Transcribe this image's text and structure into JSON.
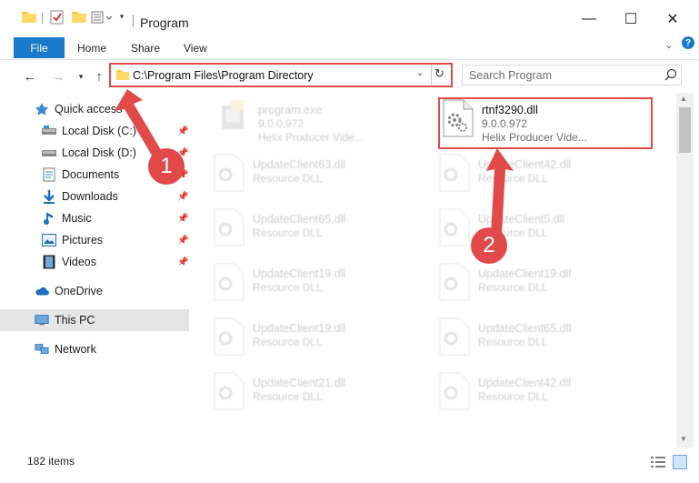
{
  "window": {
    "title": "Program",
    "minimize_glyph": "—",
    "maximize_glyph": "☐",
    "close_glyph": "✕"
  },
  "ribbon": {
    "tabs": [
      {
        "label": "File"
      },
      {
        "label": "Home"
      },
      {
        "label": "Share"
      },
      {
        "label": "View"
      }
    ]
  },
  "address": {
    "path": "C:\\Program Files\\Program Directory"
  },
  "search": {
    "placeholder": "Search Program"
  },
  "sidebar": {
    "items": [
      {
        "label": "Quick access",
        "icon": "star-icon"
      },
      {
        "label": "Local Disk (C:)",
        "icon": "drive-icon",
        "pinned": true
      },
      {
        "label": "Local Disk (D:)",
        "icon": "drive-icon",
        "pinned": true
      },
      {
        "label": "Documents",
        "icon": "documents-icon",
        "pinned": true
      },
      {
        "label": "Downloads",
        "icon": "download-icon",
        "pinned": true
      },
      {
        "label": "Music",
        "icon": "music-icon",
        "pinned": true
      },
      {
        "label": "Pictures",
        "icon": "pictures-icon",
        "pinned": true
      },
      {
        "label": "Videos",
        "icon": "videos-icon",
        "pinned": true
      },
      {
        "label": "OneDrive",
        "icon": "cloud-icon"
      },
      {
        "label": "This PC",
        "icon": "computer-icon",
        "selected": true
      },
      {
        "label": "Network",
        "icon": "network-icon"
      }
    ]
  },
  "files": {
    "program": {
      "name": "program.exe",
      "version": "9.0.0.972",
      "description": "Helix Producer Vide..."
    },
    "target": {
      "name": "rtnf3290.dll",
      "version": "9.0.0.972",
      "description": "Helix Producer Vide..."
    },
    "left_column": [
      {
        "name": "UpdateClient63.dll",
        "type": "Resource DLL"
      },
      {
        "name": "UpdateClient65.dll",
        "type": "Resource DLL"
      },
      {
        "name": "UpdateClient19.dll",
        "type": "Resource DLL"
      },
      {
        "name": "UpdateClient19.dll",
        "type": "Resource DLL"
      },
      {
        "name": "UpdateClient21.dll",
        "type": "Resource DLL"
      }
    ],
    "right_column": [
      {
        "name": "UpdateClient42.dll",
        "type": "Resource DLL"
      },
      {
        "name": "UpdateClient5.dll",
        "type": "Resource DLL"
      },
      {
        "name": "UpdateClient19.dll",
        "type": "Resource DLL"
      },
      {
        "name": "UpdateClient65.dll",
        "type": "Resource DLL"
      },
      {
        "name": "UpdateClient42.dll",
        "type": "Resource DLL"
      }
    ]
  },
  "status": {
    "item_count": "182 items"
  },
  "annotations": {
    "step1": "1",
    "step2": "2"
  },
  "colors": {
    "accent": "#1979ca",
    "annotation": "#e24a4a"
  }
}
